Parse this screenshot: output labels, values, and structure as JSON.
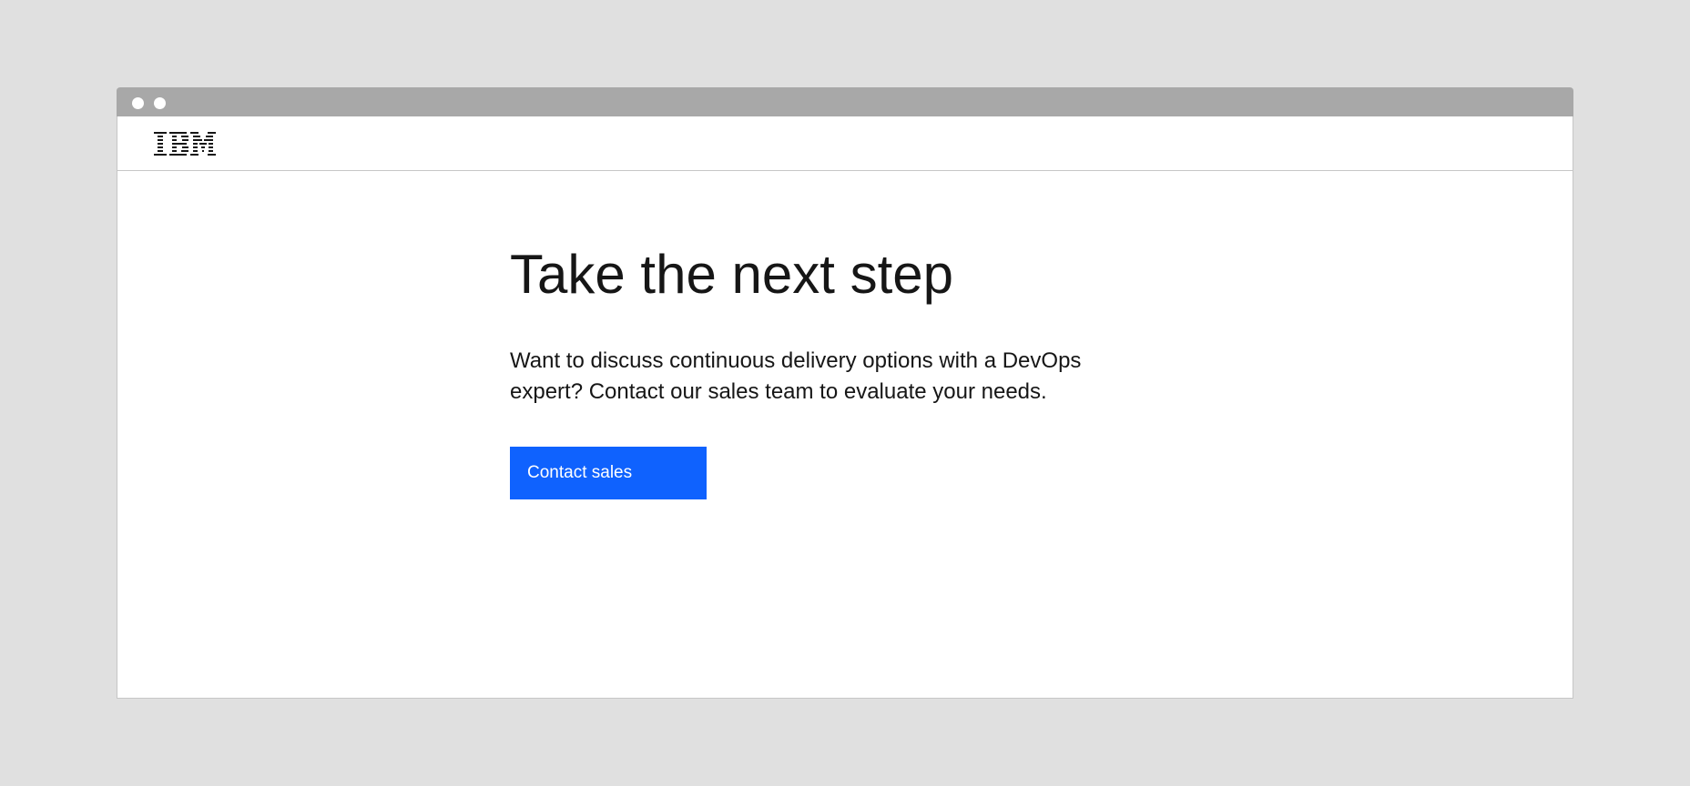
{
  "window": {
    "title_bar_dots": 2
  },
  "header": {
    "logo": "IBM",
    "logo_icon": "ibm-logo"
  },
  "main": {
    "heading": "Take the next step",
    "body": "Want to discuss continuous delivery options with a DevOps expert? Contact our sales team to evaluate your needs.",
    "cta_label": "Contact sales"
  },
  "colors": {
    "page_background": "#e0e0e0",
    "title_bar": "#a8a8a8",
    "button": "#0f62fe",
    "text": "#161616"
  }
}
